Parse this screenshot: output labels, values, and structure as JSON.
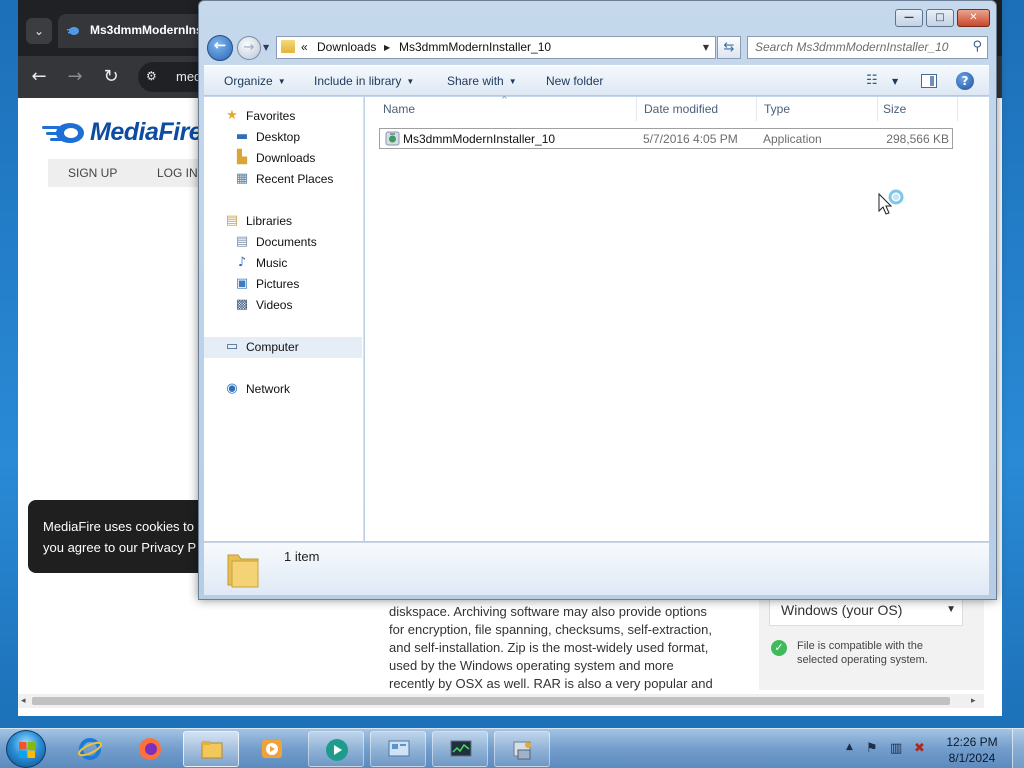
{
  "browser": {
    "tab_title": "Ms3dmmModernIns",
    "url_partial": "med",
    "logo_text": "MediaFire",
    "nav": {
      "signup": "SIGN UP",
      "login": "LOG IN"
    },
    "cookie_line1": "MediaFire uses cookies to",
    "cookie_line2": "you agree to our Privacy P",
    "description_lines": [
      "diskspace. Archiving software may also provide options",
      "for encryption, file spanning, checksums, self-extraction,",
      "and self-installation. Zip is the most-widely used format,",
      "used by the Windows operating system and more",
      "recently by OSX as well. RAR is also a very popular and"
    ],
    "os_select": "Windows (your OS)",
    "compat_text": "File is compatible with the selected operating system."
  },
  "explorer": {
    "address": {
      "overflow": "«",
      "crumb1": "Downloads",
      "crumb2": "Ms3dmmModernInstaller_10"
    },
    "search_placeholder": "Search Ms3dmmModernInstaller_10",
    "commands": {
      "organize": "Organize",
      "include_in_library": "Include in library",
      "share_with": "Share with",
      "new_folder": "New folder"
    },
    "nav": {
      "favorites": "Favorites",
      "desktop": "Desktop",
      "downloads": "Downloads",
      "recent_places": "Recent Places",
      "libraries": "Libraries",
      "documents": "Documents",
      "music": "Music",
      "pictures": "Pictures",
      "videos": "Videos",
      "computer": "Computer",
      "network": "Network"
    },
    "columns": {
      "name": "Name",
      "date_modified": "Date modified",
      "type": "Type",
      "size": "Size"
    },
    "files": [
      {
        "name": "Ms3dmmModernInstaller_10",
        "date_modified": "5/7/2016 4:05 PM",
        "type": "Application",
        "size": "298,566 KB"
      }
    ],
    "item_count": "1 item"
  },
  "taskbar": {
    "time": "12:26 PM",
    "date": "8/1/2024"
  }
}
